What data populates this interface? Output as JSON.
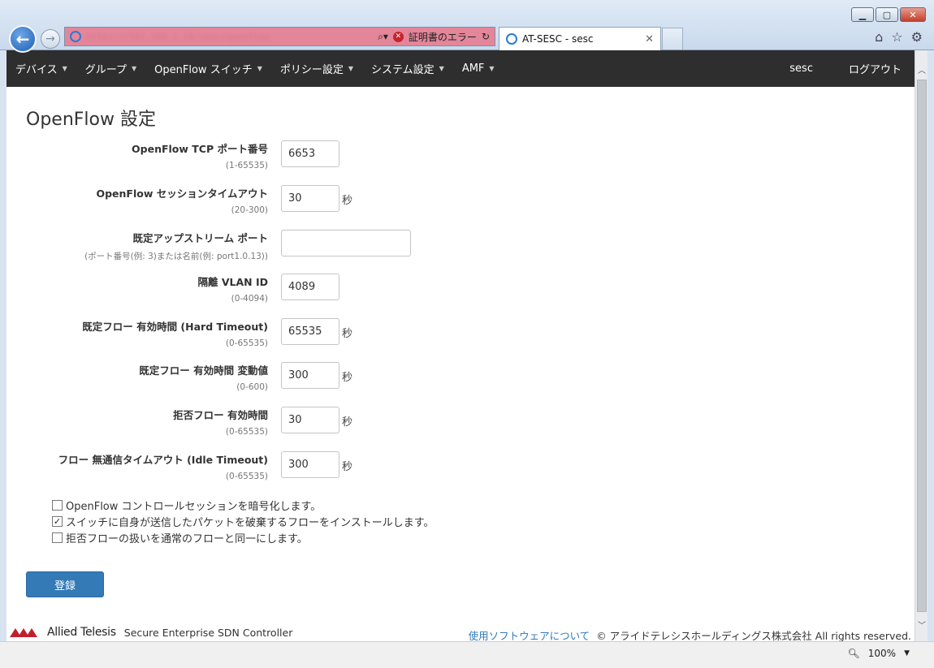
{
  "browser": {
    "address_url": "https://192.168.1.10/sesc/openflow",
    "cert_error": "証明書のエラー",
    "tab_title": "AT-SESC - sesc",
    "zoom": "100%"
  },
  "nav": {
    "items": [
      {
        "label": "デバイス"
      },
      {
        "label": "グループ"
      },
      {
        "label": "OpenFlow スイッチ"
      },
      {
        "label": "ポリシー設定"
      },
      {
        "label": "システム設定"
      },
      {
        "label": "AMF"
      }
    ],
    "user": "sesc",
    "logout": "ログアウト"
  },
  "page": {
    "title": "OpenFlow 設定"
  },
  "fields": [
    {
      "label": "OpenFlow TCP ポート番号",
      "hint": "(1-65535)",
      "value": "6653",
      "unit": ""
    },
    {
      "label": "OpenFlow セッションタイムアウト",
      "hint": "(20-300)",
      "value": "30",
      "unit": "秒"
    },
    {
      "label": "既定アップストリーム ポート",
      "hint": "(ポート番号(例: 3)または名前(例: port1.0.13))",
      "value": "",
      "unit": ""
    },
    {
      "label": "隔離 VLAN ID",
      "hint": "(0-4094)",
      "value": "4089",
      "unit": ""
    },
    {
      "label": "既定フロー 有効時間 (Hard Timeout)",
      "hint": "(0-65535)",
      "value": "65535",
      "unit": "秒"
    },
    {
      "label": "既定フロー 有効時間 変動値",
      "hint": "(0-600)",
      "value": "300",
      "unit": "秒"
    },
    {
      "label": "拒否フロー 有効時間",
      "hint": "(0-65535)",
      "value": "30",
      "unit": "秒"
    },
    {
      "label": "フロー 無通信タイムアウト (Idle Timeout)",
      "hint": "(0-65535)",
      "value": "300",
      "unit": "秒"
    }
  ],
  "checkboxes": [
    {
      "label": "OpenFlow コントロールセッションを暗号化します。",
      "checked": false
    },
    {
      "label": "スイッチに自身が送信したパケットを破棄するフローをインストールします。",
      "checked": true
    },
    {
      "label": "拒否フローの扱いを通常のフローと同一にします。",
      "checked": false
    }
  ],
  "submit_label": "登録",
  "footer": {
    "brand": "Allied Telesis",
    "product": "Secure Enterprise SDN Controller",
    "software_link": "使用ソフトウェアについて",
    "copyright": "© アライドテレシスホールディングス株式会社 All rights reserved."
  }
}
